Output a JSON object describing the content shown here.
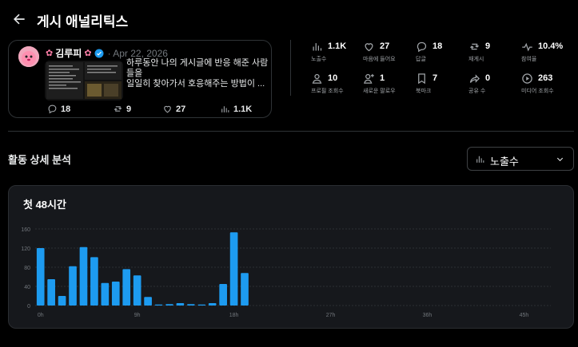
{
  "header": {
    "title": "게시 애널리틱스"
  },
  "post": {
    "author_name": "김루피",
    "date": "Apr 22, 2026",
    "text_line1": "하루동안 나의 게시글에 반응 해준 사람",
    "text_line2": "들을",
    "text_line3": "일일히 찾아가서 호응해주는 방법이 ...",
    "stats": {
      "replies": "18",
      "reposts": "9",
      "likes": "27",
      "views": "1.1K"
    }
  },
  "metrics": [
    {
      "icon": "bar-chart-icon",
      "value": "1.1K",
      "label": "노출수"
    },
    {
      "icon": "heart-icon",
      "value": "27",
      "label": "마음에 들어요"
    },
    {
      "icon": "reply-icon",
      "value": "18",
      "label": "답글"
    },
    {
      "icon": "repost-icon",
      "value": "9",
      "label": "재게시"
    },
    {
      "icon": "activity-icon",
      "value": "10.4%",
      "label": "참여율"
    },
    {
      "icon": "profile-icon",
      "value": "10",
      "label": "프로필 조회수"
    },
    {
      "icon": "follow-icon",
      "value": "1",
      "label": "새로운 팔로우"
    },
    {
      "icon": "bookmark-icon",
      "value": "7",
      "label": "북마크"
    },
    {
      "icon": "share-icon",
      "value": "0",
      "label": "공유 수"
    },
    {
      "icon": "play-icon",
      "value": "263",
      "label": "미디어 조회수"
    }
  ],
  "section": {
    "title": "활동 상세 분석",
    "selected_metric": "노출수"
  },
  "chart_data": {
    "type": "bar",
    "title": "첫 48시간",
    "x": [
      0,
      1,
      2,
      3,
      4,
      5,
      6,
      7,
      8,
      9,
      10,
      11,
      12,
      13,
      14,
      15,
      16,
      17,
      18,
      19
    ],
    "values": [
      120,
      55,
      20,
      82,
      122,
      101,
      47,
      50,
      76,
      63,
      18,
      2,
      3,
      5,
      3,
      2,
      5,
      45,
      153,
      68
    ],
    "x_ticks": [
      "0h",
      "9h",
      "18h",
      "27h",
      "36h",
      "45h"
    ],
    "x_tick_positions": [
      0,
      9,
      18,
      27,
      36,
      45
    ],
    "y_ticks": [
      "0",
      "40",
      "80",
      "120",
      "160"
    ],
    "ylim": [
      0,
      160
    ],
    "xlim": [
      0,
      48
    ],
    "grid": true,
    "bar_color": "#1d9bf0"
  }
}
